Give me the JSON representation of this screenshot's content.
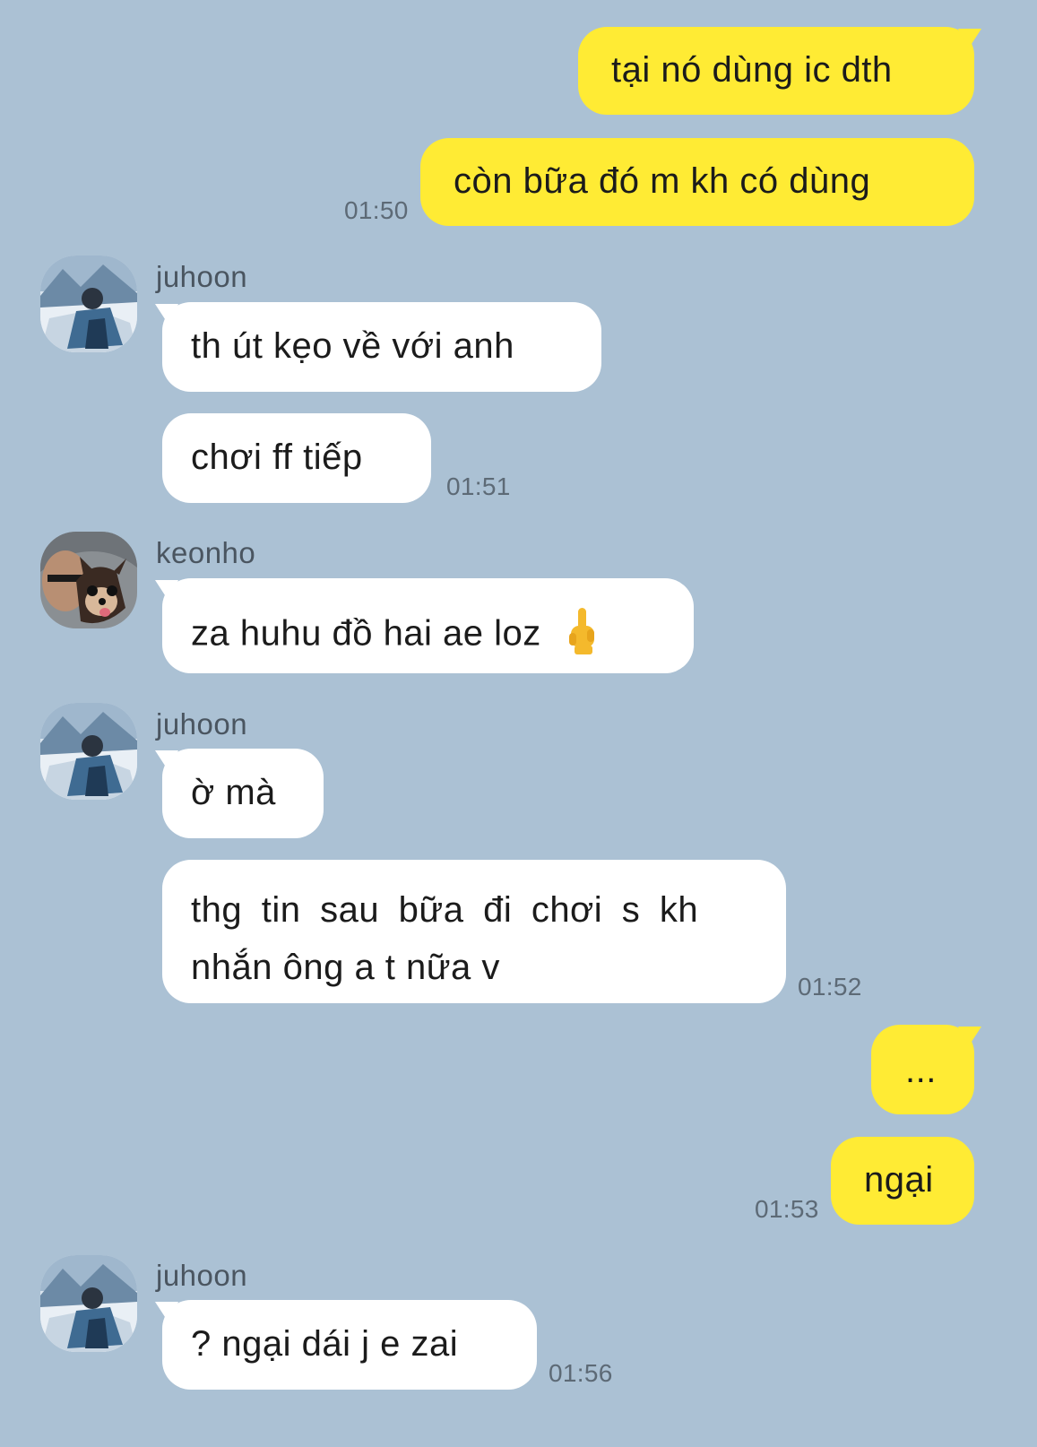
{
  "messages": [
    {
      "direction": "out",
      "text": "tại nó dùng ic dth"
    },
    {
      "direction": "out",
      "text": "còn bữa đó m kh có dùng",
      "time": "01:50"
    },
    {
      "direction": "in",
      "sender": "juhoon",
      "avatar": "mountain-avatar",
      "text": "th út kẹo về với anh"
    },
    {
      "direction": "in",
      "text": "chơi ff tiếp",
      "time": "01:51"
    },
    {
      "direction": "in",
      "sender": "keonho",
      "avatar": "dog-avatar",
      "text": "za huhu đồ hai ae loz",
      "emoji": "middle-finger-icon"
    },
    {
      "direction": "in",
      "sender": "juhoon",
      "avatar": "mountain-avatar",
      "text": "ờ mà"
    },
    {
      "direction": "in",
      "text_line1": "thg tin sau bữa đi chơi s kh",
      "text_line2": "nhắn ông a t nữa v",
      "time": "01:52"
    },
    {
      "direction": "out",
      "text": "..."
    },
    {
      "direction": "out",
      "text": "ngại",
      "time": "01:53"
    },
    {
      "direction": "in",
      "sender": "juhoon",
      "avatar": "mountain-avatar",
      "text": "? ngại dái j e zai",
      "time": "01:56"
    }
  ],
  "colors": {
    "background": "#abc1d4",
    "outgoing_bubble": "#ffeb34",
    "incoming_bubble": "#ffffff",
    "timestamp": "#5d6a76",
    "sender": "#4a5560"
  }
}
